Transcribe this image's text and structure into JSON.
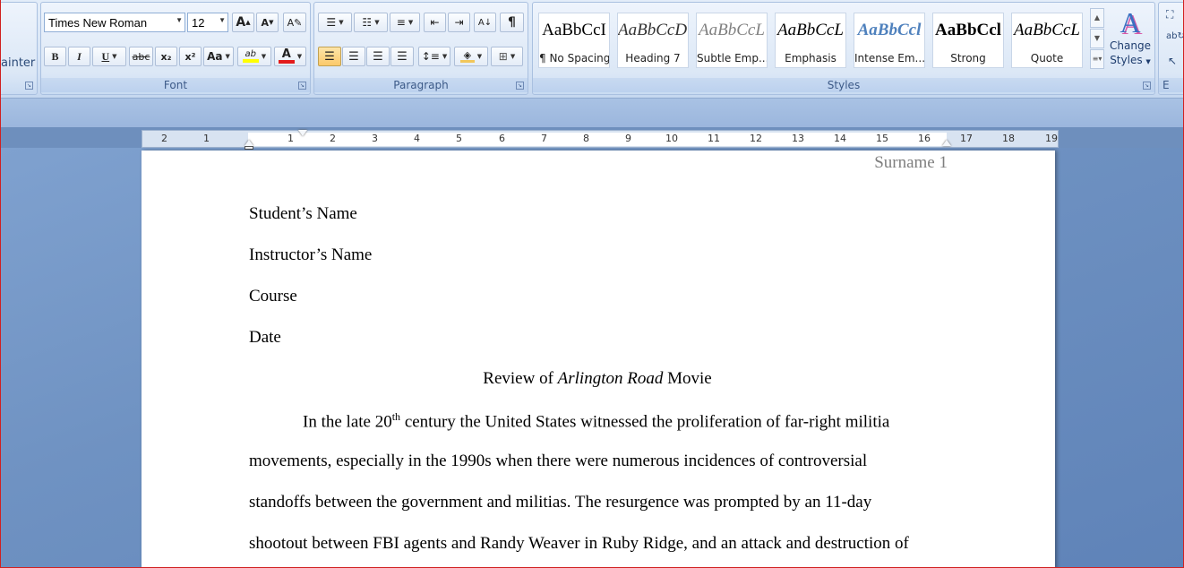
{
  "clipboard": {
    "painter_label": "ainter"
  },
  "font_group": {
    "label": "Font",
    "font_name": "Times New Roman",
    "font_size": "12",
    "grow_label": "A",
    "shrink_label": "A",
    "bold": "B",
    "italic": "I",
    "underline": "U",
    "strike": "abc",
    "subscript": "x₂",
    "superscript": "x²",
    "change_case": "Aa",
    "highlight_label": "ab",
    "font_color_label": "A"
  },
  "paragraph_group": {
    "label": "Paragraph",
    "pilcrow": "¶"
  },
  "styles_group": {
    "label": "Styles",
    "tiles": [
      {
        "sample": "AaBbCcI",
        "name": "¶ No Spacing"
      },
      {
        "sample": "AaBbCcDı",
        "name": "Heading 7"
      },
      {
        "sample": "AaBbCcL",
        "name": "Subtle Emp..."
      },
      {
        "sample": "AaBbCcL",
        "name": "Emphasis"
      },
      {
        "sample": "AaBbCcl",
        "name": "Intense Em..."
      },
      {
        "sample": "AaBbCcl",
        "name": "Strong"
      },
      {
        "sample": "AaBbCcL",
        "name": "Quote"
      }
    ],
    "change_styles_line1": "Change",
    "change_styles_line2": "Styles",
    "change_styles_icon": "A"
  },
  "editing_group": {
    "label": "E"
  },
  "ruler": {
    "numbers": [
      "2",
      "1",
      "1",
      "1",
      "2",
      "3",
      "4",
      "5",
      "6",
      "7",
      "8",
      "9",
      "10",
      "11",
      "12",
      "13",
      "14",
      "15",
      "16",
      "17",
      "18",
      "19"
    ]
  },
  "document": {
    "header": "Surname 1",
    "lines": [
      "Student’s Name",
      "Instructor’s Name",
      "Course",
      "Date"
    ],
    "title_prefix": "Review of ",
    "title_italic": "Arlington Road",
    "title_suffix": " Movie",
    "para_start": "In the late 20",
    "para_sup": "th",
    "para_rest": " century the United States witnessed the proliferation of far-right militia",
    "para_lines": [
      "movements, especially in the 1990s when there were numerous incidences of controversial",
      "standoffs between the government and militias. The resurgence was prompted by an 11-day",
      "shootout between FBI agents and Randy Weaver in Ruby Ridge, and an attack and destruction of"
    ]
  },
  "colors": {
    "highlight": "#ffff00",
    "font_color": "#e31b1b",
    "intense_emphasis": "#4f81bd",
    "subtle_emphasis": "#808080",
    "header_text": "#7f7f7f"
  }
}
